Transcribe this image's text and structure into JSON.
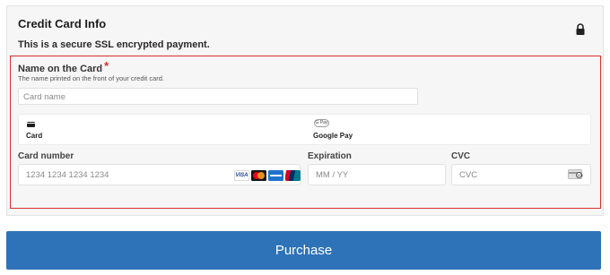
{
  "panel": {
    "title": "Credit Card Info",
    "secure_note": "This is a secure SSL encrypted payment."
  },
  "name_field": {
    "label": "Name on the Card",
    "required_mark": "*",
    "help": "The name printed on the front of your credit card.",
    "placeholder": "Card name",
    "value": ""
  },
  "payment_methods": [
    {
      "label": "Card",
      "icon": "credit-card-icon",
      "selected": true
    },
    {
      "label": "Google Pay",
      "icon": "google-pay-icon",
      "icon_text": "G Pay",
      "selected": false
    }
  ],
  "card_number": {
    "label": "Card number",
    "placeholder": "1234 1234 1234 1234",
    "brands": [
      {
        "name": "visa-icon",
        "text": "VISA"
      },
      {
        "name": "mastercard-icon"
      },
      {
        "name": "amex-icon"
      },
      {
        "name": "unionpay-icon"
      }
    ]
  },
  "expiration": {
    "label": "Expiration",
    "placeholder": "MM / YY"
  },
  "cvc": {
    "label": "CVC",
    "placeholder": "CVC",
    "icon": "cvc-card-icon",
    "icon_text": "123"
  },
  "purchase_button": {
    "label": "Purchase"
  },
  "colors": {
    "accent": "#2e73b8",
    "error_border": "#d9302c",
    "panel_bg": "#f6f6f6"
  }
}
